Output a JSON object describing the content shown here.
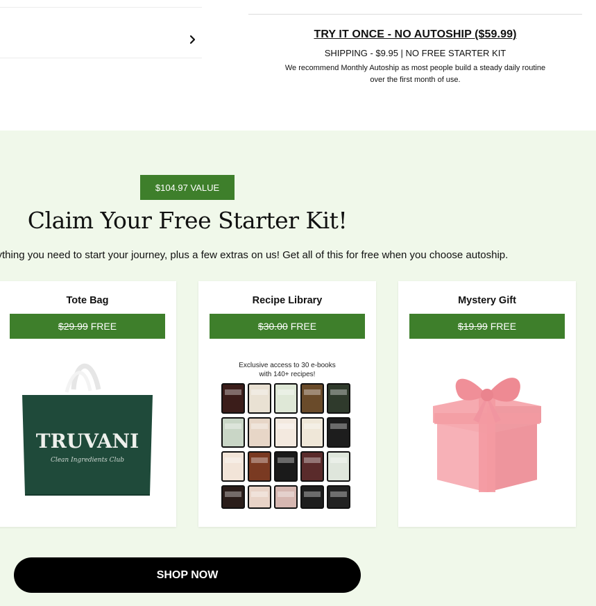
{
  "purchase_option": {
    "title": "TRY IT ONCE - NO AUTOSHIP ($59.99)",
    "shipping": "SHIPPING - $9.95 | NO FREE STARTER KIT",
    "note": "We recommend Monthly Autoship as most people build a steady daily routine over the first month of use."
  },
  "starter_kit": {
    "value_badge": "$104.97 VALUE",
    "headline": "Claim Your Free Starter Kit!",
    "subline": "Everything you need to start your journey, plus a few extras on us! Get all of this for free when you choose autoship.",
    "items": [
      {
        "title": "Tote Bag",
        "old_price": "$29.99",
        "free_label": "FREE",
        "image_brand": "TRUVANI",
        "image_sub": "Clean Ingredients Club"
      },
      {
        "title": "Recipe Library",
        "old_price": "$30.00",
        "free_label": "FREE",
        "image_caption_line1": "Exclusive access to 30 e-books",
        "image_caption_line2": "with 140+ recipes!"
      },
      {
        "title": "Mystery Gift",
        "old_price": "$19.99",
        "free_label": "FREE"
      }
    ],
    "cta": "SHOP NOW"
  },
  "colors": {
    "green": "#3e7f2b",
    "section_bg": "#f0f8ea",
    "tote": "#1f4a3a",
    "gift": "#f29aa1"
  }
}
